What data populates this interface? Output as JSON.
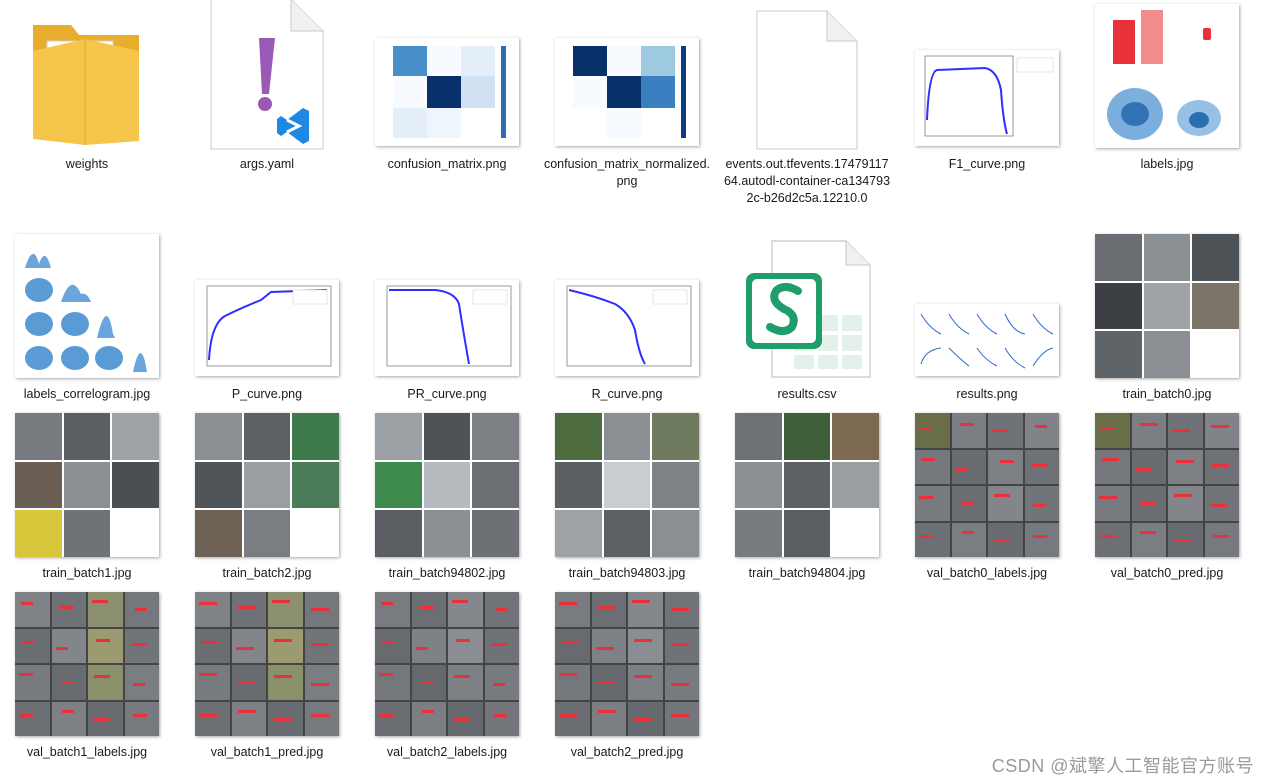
{
  "files": [
    {
      "name": "weights",
      "icon": "folder-icon"
    },
    {
      "name": "args.yaml",
      "icon": "yaml-file-icon"
    },
    {
      "name": "confusion_matrix.png",
      "icon": "image-thumbnail"
    },
    {
      "name": "confusion_matrix_normalized.png",
      "icon": "image-thumbnail"
    },
    {
      "name": "events.out.tfevents.1747911764.autodl-container-ca1347932c-b26d2c5a.12210.0",
      "icon": "blank-file-icon"
    },
    {
      "name": "F1_curve.png",
      "icon": "image-thumbnail"
    },
    {
      "name": "labels.jpg",
      "icon": "image-thumbnail"
    },
    {
      "name": "labels_correlogram.jpg",
      "icon": "image-thumbnail"
    },
    {
      "name": "P_curve.png",
      "icon": "image-thumbnail"
    },
    {
      "name": "PR_curve.png",
      "icon": "image-thumbnail"
    },
    {
      "name": "R_curve.png",
      "icon": "image-thumbnail"
    },
    {
      "name": "results.csv",
      "icon": "spreadsheet-file-icon"
    },
    {
      "name": "results.png",
      "icon": "image-thumbnail"
    },
    {
      "name": "train_batch0.jpg",
      "icon": "image-thumbnail"
    },
    {
      "name": "train_batch1.jpg",
      "icon": "image-thumbnail"
    },
    {
      "name": "train_batch2.jpg",
      "icon": "image-thumbnail"
    },
    {
      "name": "train_batch94802.jpg",
      "icon": "image-thumbnail"
    },
    {
      "name": "train_batch94803.jpg",
      "icon": "image-thumbnail"
    },
    {
      "name": "train_batch94804.jpg",
      "icon": "image-thumbnail"
    },
    {
      "name": "val_batch0_labels.jpg",
      "icon": "image-thumbnail"
    },
    {
      "name": "val_batch0_pred.jpg",
      "icon": "image-thumbnail"
    },
    {
      "name": "val_batch1_labels.jpg",
      "icon": "image-thumbnail"
    },
    {
      "name": "val_batch1_pred.jpg",
      "icon": "image-thumbnail"
    },
    {
      "name": "val_batch2_labels.jpg",
      "icon": "image-thumbnail"
    },
    {
      "name": "val_batch2_pred.jpg",
      "icon": "image-thumbnail"
    }
  ],
  "watermark": "CSDN @斌擎人工智能官方账号",
  "colors": {
    "folder": "#f6c64a",
    "yaml_mark": "#9b59b6",
    "vscode_blue": "#1e88e5",
    "spreadsheet_green": "#1f9d6b",
    "matrix_dark": "#08306b",
    "curve_blue": "#2e2eff",
    "bbox_red": "#e8313b"
  }
}
